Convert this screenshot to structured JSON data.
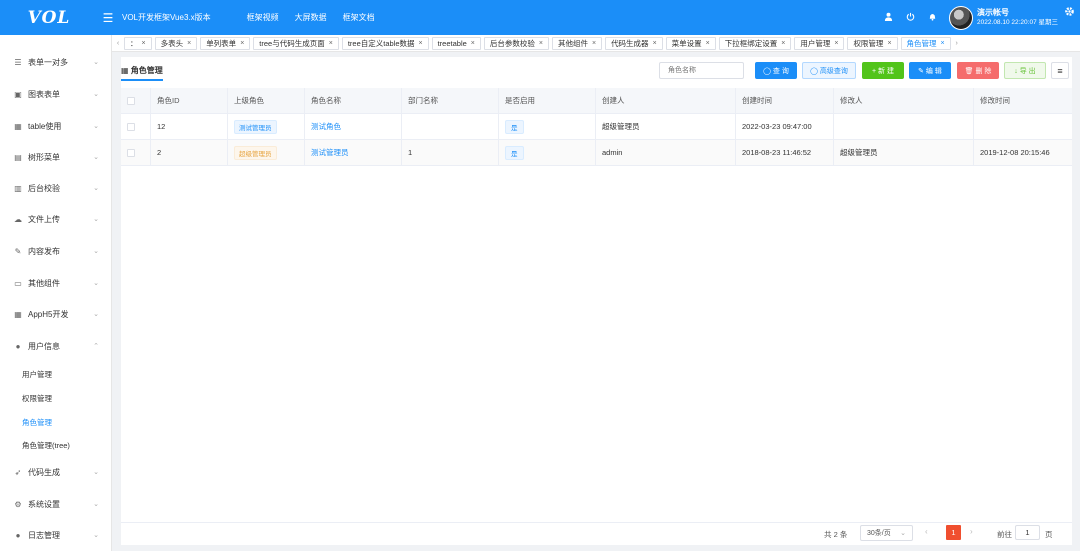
{
  "header": {
    "logo": "VOL",
    "menu_icon": "☰",
    "app_title": "VOL开发框架Vue3.x版本",
    "nav": [
      "框架视频",
      "大屏数据",
      "框架文档"
    ],
    "user_name": "演示帐号",
    "datetime": "2022.08.10 22:20:07 星期三"
  },
  "sidebar": {
    "items": [
      {
        "label": "表单一对多",
        "icon": "☰",
        "arrow": "⌄"
      },
      {
        "label": "图表表单",
        "icon": "▣",
        "arrow": "⌄"
      },
      {
        "label": "table使用",
        "icon": "▦",
        "arrow": "⌄"
      },
      {
        "label": "树形菜单",
        "icon": "▤",
        "arrow": "⌄"
      },
      {
        "label": "后台校验",
        "icon": "▥",
        "arrow": "⌄"
      },
      {
        "label": "文件上传",
        "icon": "☁",
        "arrow": "⌄"
      },
      {
        "label": "内容发布",
        "icon": "✎",
        "arrow": "⌄"
      },
      {
        "label": "其他组件",
        "icon": "▭",
        "arrow": "⌄"
      },
      {
        "label": "AppH5开发",
        "icon": "▦",
        "arrow": "⌄"
      },
      {
        "label": "用户信息",
        "icon": "●",
        "arrow": "⌃"
      },
      {
        "label": "代码生成",
        "icon": "➶",
        "arrow": "⌄"
      },
      {
        "label": "系统设置",
        "icon": "⚙",
        "arrow": "⌄"
      },
      {
        "label": "日志管理",
        "icon": "●",
        "arrow": "⌄"
      }
    ],
    "subitems": [
      "用户管理",
      "权限管理",
      "角色管理",
      "角色管理(tree)"
    ]
  },
  "tabs": {
    "left_arrow": "‹",
    "right_arrow": "›",
    "close": "×",
    "items": [
      "：",
      "多表头",
      "单列表单",
      "tree与代码生成页面",
      "tree自定义table数据",
      "treetable",
      "后台参数校验",
      "其他组件",
      "代码生成器",
      "菜单设置",
      "下拉框绑定设置",
      "用户管理",
      "权限管理",
      "角色管理"
    ]
  },
  "main": {
    "title": "角色管理",
    "title_icon": "▦",
    "search_placeholder": "角色名称",
    "buttons": {
      "query": "◯ 查 询",
      "advanced": "◯ 高级查询",
      "add": "+ 新 建",
      "edit": "✎ 编 辑",
      "delete": "🗑 删 除",
      "export": "↓ 导 出",
      "more": "≡"
    },
    "columns": [
      "角色ID",
      "上级角色",
      "角色名称",
      "部门名称",
      "是否启用",
      "创建人",
      "创建时间",
      "修改人",
      "修改时间"
    ],
    "rows": [
      {
        "id": "12",
        "parent": "测试管理员",
        "parent_style": "blue",
        "name": "测试角色",
        "dept": "",
        "enabled": "是",
        "creator": "超级管理员",
        "created": "2022-03-23 09:47:00",
        "modifier": "",
        "modified": ""
      },
      {
        "id": "2",
        "parent": "超级管理员",
        "parent_style": "orange",
        "name": "测试管理员",
        "dept": "1",
        "enabled": "是",
        "creator": "admin",
        "created": "2018-08-23 11:46:52",
        "modifier": "超级管理员",
        "modified": "2019-12-08 20:15:46"
      }
    ]
  },
  "pager": {
    "total": "共 2 条",
    "page_size": "30条/页",
    "size_caret": "⌄",
    "prev": "‹",
    "current": "1",
    "next": "›",
    "goto": "前往",
    "goto_value": "1",
    "page_unit": "页"
  }
}
